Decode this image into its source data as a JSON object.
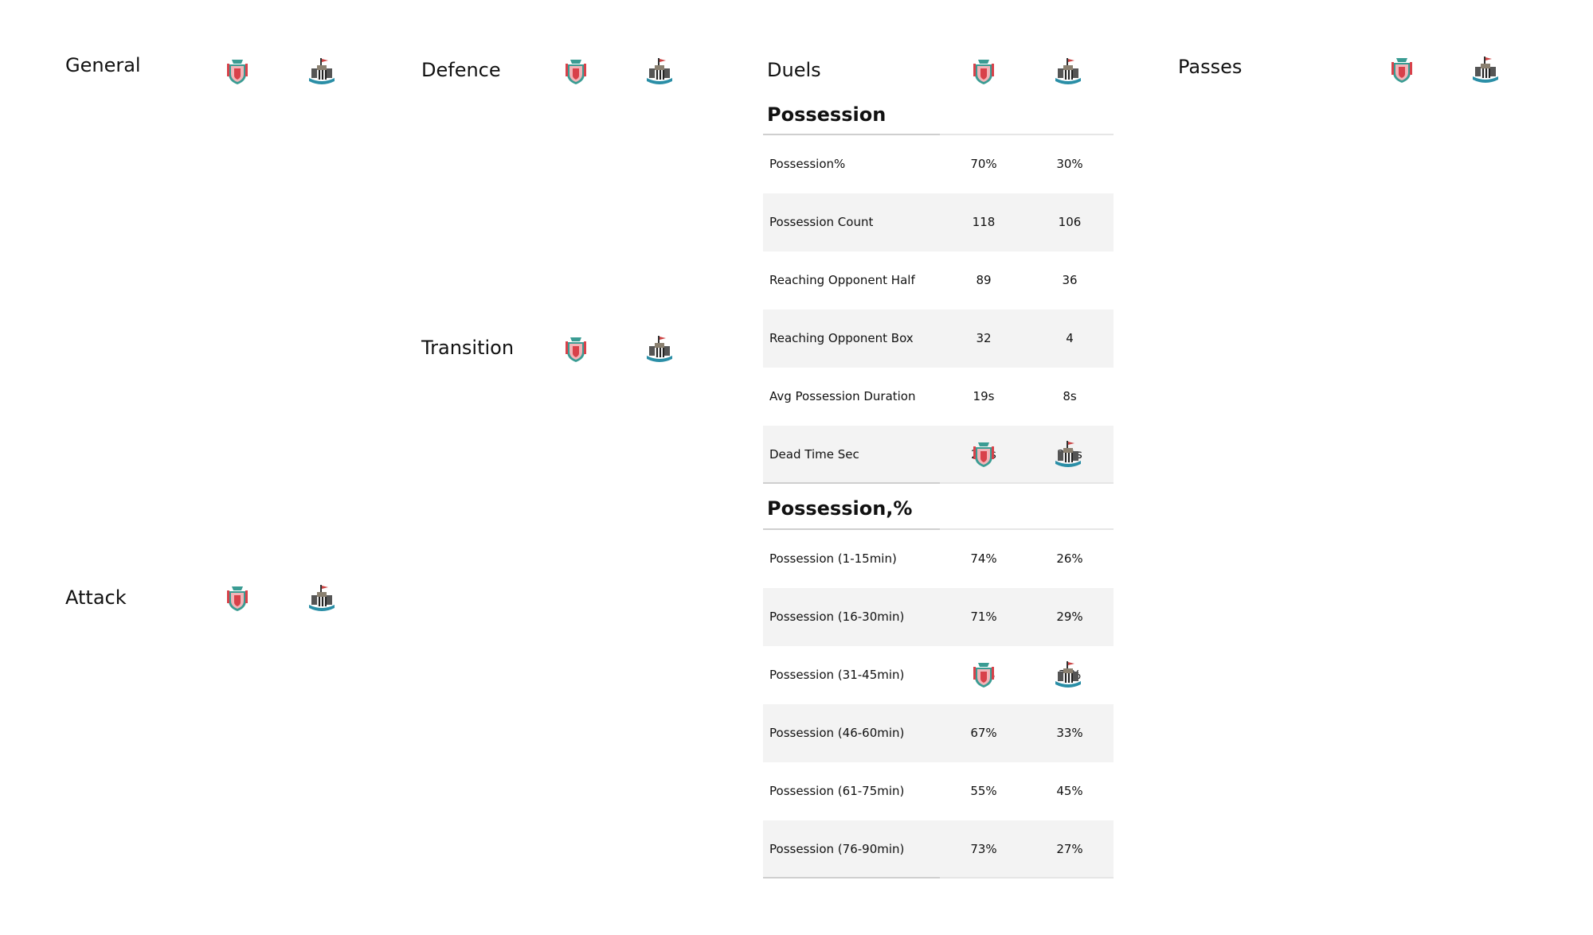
{
  "panels": {
    "general": "General",
    "defence": "Defence",
    "duels": "Duels",
    "passes": "Passes",
    "transition": "Transition",
    "attack": "Attack"
  },
  "teams": [
    {
      "icon": "liverpool-crest-icon",
      "colors": [
        "#d8414a",
        "#3a9c93"
      ]
    },
    {
      "icon": "newcastle-crest-icon",
      "colors": [
        "#222222",
        "#2a8ea6"
      ]
    }
  ],
  "table": {
    "sections": [
      {
        "title": "Possession",
        "rows": [
          {
            "label": "Possession%",
            "home": "70%",
            "away": "30%"
          },
          {
            "label": "Possession Count",
            "home": "118",
            "away": "106"
          },
          {
            "label": "Reaching Opponent Half",
            "home": "89",
            "away": "36"
          },
          {
            "label": "Reaching Opponent Box",
            "home": "32",
            "away": "4"
          },
          {
            "label": "Avg Possession Duration",
            "home": "19s",
            "away": "8s"
          },
          {
            "label": "Dead Time Sec",
            "home": "2   1s",
            "away": "2   1s"
          }
        ]
      },
      {
        "title": "Possession,%",
        "rows": [
          {
            "label": "Possession (1-15min)",
            "home": "74%",
            "away": "26%"
          },
          {
            "label": "Possession (16-30min)",
            "home": "71%",
            "away": "29%"
          },
          {
            "label": "Possession (31-45min)",
            "home": "7 %",
            "away": "3 %"
          },
          {
            "label": "Possession (46-60min)",
            "home": "67%",
            "away": "33%"
          },
          {
            "label": "Possession (61-75min)",
            "home": "55%",
            "away": "45%"
          },
          {
            "label": "Possession (76-90min)",
            "home": "73%",
            "away": "27%"
          }
        ]
      }
    ]
  }
}
